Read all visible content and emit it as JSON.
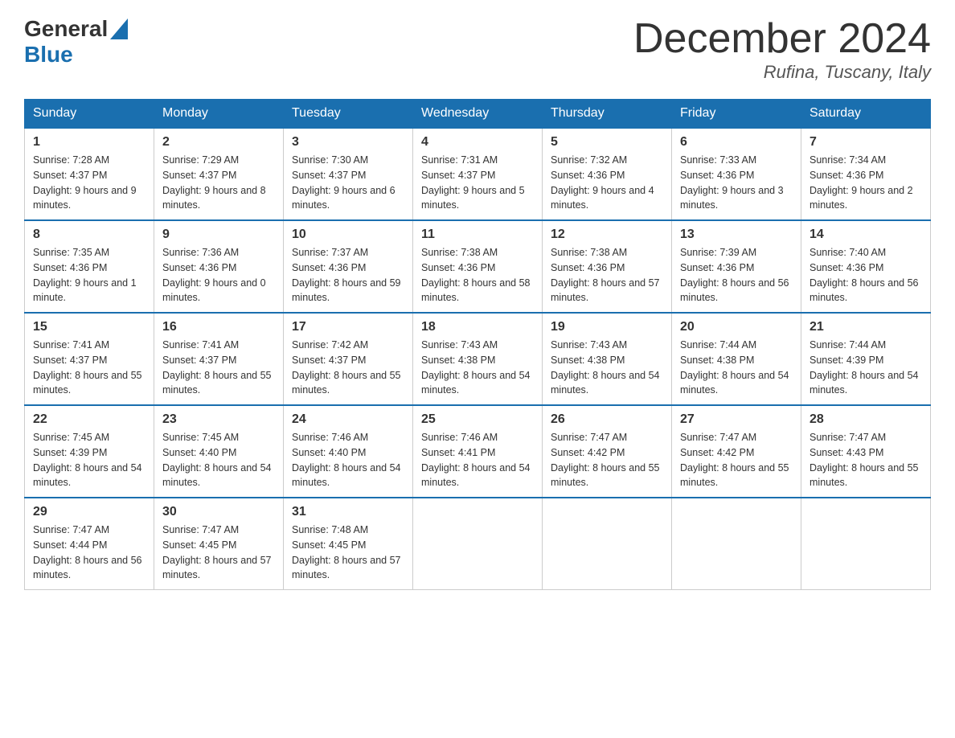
{
  "header": {
    "logo_general": "General",
    "logo_blue": "Blue",
    "month_title": "December 2024",
    "location": "Rufina, Tuscany, Italy"
  },
  "days_of_week": [
    "Sunday",
    "Monday",
    "Tuesday",
    "Wednesday",
    "Thursday",
    "Friday",
    "Saturday"
  ],
  "weeks": [
    [
      {
        "day": "1",
        "sunrise": "7:28 AM",
        "sunset": "4:37 PM",
        "daylight": "9 hours and 9 minutes."
      },
      {
        "day": "2",
        "sunrise": "7:29 AM",
        "sunset": "4:37 PM",
        "daylight": "9 hours and 8 minutes."
      },
      {
        "day": "3",
        "sunrise": "7:30 AM",
        "sunset": "4:37 PM",
        "daylight": "9 hours and 6 minutes."
      },
      {
        "day": "4",
        "sunrise": "7:31 AM",
        "sunset": "4:37 PM",
        "daylight": "9 hours and 5 minutes."
      },
      {
        "day": "5",
        "sunrise": "7:32 AM",
        "sunset": "4:36 PM",
        "daylight": "9 hours and 4 minutes."
      },
      {
        "day": "6",
        "sunrise": "7:33 AM",
        "sunset": "4:36 PM",
        "daylight": "9 hours and 3 minutes."
      },
      {
        "day": "7",
        "sunrise": "7:34 AM",
        "sunset": "4:36 PM",
        "daylight": "9 hours and 2 minutes."
      }
    ],
    [
      {
        "day": "8",
        "sunrise": "7:35 AM",
        "sunset": "4:36 PM",
        "daylight": "9 hours and 1 minute."
      },
      {
        "day": "9",
        "sunrise": "7:36 AM",
        "sunset": "4:36 PM",
        "daylight": "9 hours and 0 minutes."
      },
      {
        "day": "10",
        "sunrise": "7:37 AM",
        "sunset": "4:36 PM",
        "daylight": "8 hours and 59 minutes."
      },
      {
        "day": "11",
        "sunrise": "7:38 AM",
        "sunset": "4:36 PM",
        "daylight": "8 hours and 58 minutes."
      },
      {
        "day": "12",
        "sunrise": "7:38 AM",
        "sunset": "4:36 PM",
        "daylight": "8 hours and 57 minutes."
      },
      {
        "day": "13",
        "sunrise": "7:39 AM",
        "sunset": "4:36 PM",
        "daylight": "8 hours and 56 minutes."
      },
      {
        "day": "14",
        "sunrise": "7:40 AM",
        "sunset": "4:36 PM",
        "daylight": "8 hours and 56 minutes."
      }
    ],
    [
      {
        "day": "15",
        "sunrise": "7:41 AM",
        "sunset": "4:37 PM",
        "daylight": "8 hours and 55 minutes."
      },
      {
        "day": "16",
        "sunrise": "7:41 AM",
        "sunset": "4:37 PM",
        "daylight": "8 hours and 55 minutes."
      },
      {
        "day": "17",
        "sunrise": "7:42 AM",
        "sunset": "4:37 PM",
        "daylight": "8 hours and 55 minutes."
      },
      {
        "day": "18",
        "sunrise": "7:43 AM",
        "sunset": "4:38 PM",
        "daylight": "8 hours and 54 minutes."
      },
      {
        "day": "19",
        "sunrise": "7:43 AM",
        "sunset": "4:38 PM",
        "daylight": "8 hours and 54 minutes."
      },
      {
        "day": "20",
        "sunrise": "7:44 AM",
        "sunset": "4:38 PM",
        "daylight": "8 hours and 54 minutes."
      },
      {
        "day": "21",
        "sunrise": "7:44 AM",
        "sunset": "4:39 PM",
        "daylight": "8 hours and 54 minutes."
      }
    ],
    [
      {
        "day": "22",
        "sunrise": "7:45 AM",
        "sunset": "4:39 PM",
        "daylight": "8 hours and 54 minutes."
      },
      {
        "day": "23",
        "sunrise": "7:45 AM",
        "sunset": "4:40 PM",
        "daylight": "8 hours and 54 minutes."
      },
      {
        "day": "24",
        "sunrise": "7:46 AM",
        "sunset": "4:40 PM",
        "daylight": "8 hours and 54 minutes."
      },
      {
        "day": "25",
        "sunrise": "7:46 AM",
        "sunset": "4:41 PM",
        "daylight": "8 hours and 54 minutes."
      },
      {
        "day": "26",
        "sunrise": "7:47 AM",
        "sunset": "4:42 PM",
        "daylight": "8 hours and 55 minutes."
      },
      {
        "day": "27",
        "sunrise": "7:47 AM",
        "sunset": "4:42 PM",
        "daylight": "8 hours and 55 minutes."
      },
      {
        "day": "28",
        "sunrise": "7:47 AM",
        "sunset": "4:43 PM",
        "daylight": "8 hours and 55 minutes."
      }
    ],
    [
      {
        "day": "29",
        "sunrise": "7:47 AM",
        "sunset": "4:44 PM",
        "daylight": "8 hours and 56 minutes."
      },
      {
        "day": "30",
        "sunrise": "7:47 AM",
        "sunset": "4:45 PM",
        "daylight": "8 hours and 57 minutes."
      },
      {
        "day": "31",
        "sunrise": "7:48 AM",
        "sunset": "4:45 PM",
        "daylight": "8 hours and 57 minutes."
      },
      null,
      null,
      null,
      null
    ]
  ],
  "labels": {
    "sunrise": "Sunrise:",
    "sunset": "Sunset:",
    "daylight": "Daylight:"
  }
}
